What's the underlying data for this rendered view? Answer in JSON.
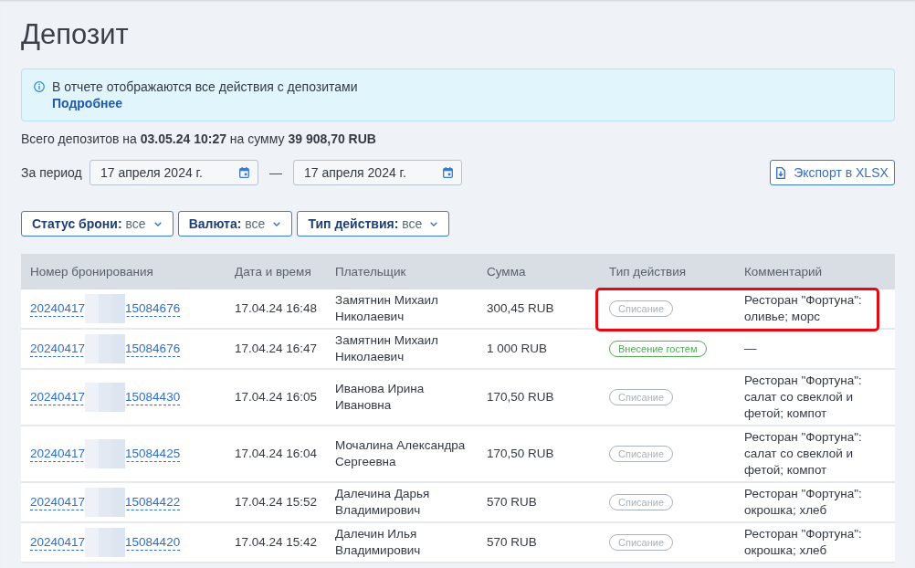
{
  "page": {
    "title": "Депозит"
  },
  "info": {
    "text": "В отчете отображаются все действия с депозитами",
    "link": "Подробнее"
  },
  "summary": "Всего депозитов на **03.05.24 10:27** на сумму **39 908,70 RUB**",
  "period": {
    "label": "За период",
    "from": "17 апреля 2024 г.",
    "separator": "—",
    "to": "17 апреля 2024 г."
  },
  "export_button": "Экспорт в XLSX",
  "filters": [
    {
      "label": "Статус брони:",
      "value": "все"
    },
    {
      "label": "Валюта:",
      "value": "все"
    },
    {
      "label": "Тип действия:",
      "value": "все"
    }
  ],
  "table": {
    "columns": [
      "Номер бронирования",
      "Дата и время",
      "Плательщик",
      "Сумма",
      "Тип действия",
      "Комментарий"
    ],
    "rows": [
      {
        "booking_start": "20240417",
        "booking_end": "15084676",
        "datetime": "17.04.24 16:48",
        "payer": "Замятнин Михаил Николаевич",
        "amount": "300,45 RUB",
        "action": {
          "label": "Списание",
          "color": "#a9b1bc"
        },
        "comment": "Ресторан \"Фортуна\": оливье; морс",
        "highlighted": true
      },
      {
        "booking_start": "20240417",
        "booking_end": "15084676",
        "datetime": "17.04.24 16:47",
        "payer": "Замятнин Михаил Николаевич",
        "amount": "1 000 RUB",
        "action": {
          "label": "Внесение гостем",
          "color": "#4cae4f"
        },
        "comment": "—",
        "highlighted": false
      },
      {
        "booking_start": "20240417",
        "booking_end": "15084430",
        "datetime": "17.04.24 16:05",
        "payer": "Иванова Ирина Ивановна",
        "amount": "170,50 RUB",
        "action": {
          "label": "Списание",
          "color": "#a9b1bc"
        },
        "comment": "Ресторан \"Фортуна\": салат со свеклой и фетой; компот",
        "highlighted": false
      },
      {
        "booking_start": "20240417",
        "booking_end": "15084425",
        "datetime": "17.04.24 16:04",
        "payer": "Мочалина Александра Сергеевна",
        "amount": "170,50 RUB",
        "action": {
          "label": "Списание",
          "color": "#a9b1bc"
        },
        "comment": "Ресторан \"Фортуна\": салат со свеклой и фетой; компот",
        "highlighted": false
      },
      {
        "booking_start": "20240417",
        "booking_end": "15084422",
        "datetime": "17.04.24 15:52",
        "payer": "Далечина Дарья Владимирович",
        "amount": "570 RUB",
        "action": {
          "label": "Списание",
          "color": "#a9b1bc"
        },
        "comment": "Ресторан \"Фортуна\": окрошка; хлеб",
        "highlighted": false
      },
      {
        "booking_start": "20240417",
        "booking_end": "15084420",
        "datetime": "17.04.24 15:42",
        "payer": "Далечин Илья Владимирович",
        "amount": "570 RUB",
        "action": {
          "label": "Списание",
          "color": "#a9b1bc"
        },
        "comment": "Ресторан \"Фортуна\": окрошка; хлеб",
        "highlighted": false
      }
    ]
  }
}
